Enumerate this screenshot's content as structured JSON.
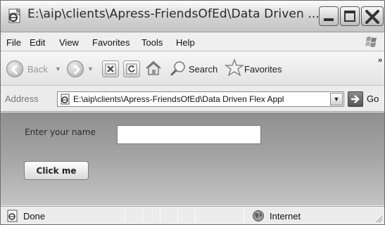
{
  "window": {
    "title": "E:\\aip\\clients\\Apress-FriendsOfEd\\Data Driven ..."
  },
  "menu": {
    "items": [
      "File",
      "Edit",
      "View",
      "Favorites",
      "Tools",
      "Help"
    ]
  },
  "toolbar": {
    "back_label": "Back",
    "search_label": "Search",
    "favorites_label": "Favorites",
    "overflow": "»"
  },
  "address": {
    "label": "Address",
    "value": "E:\\aip\\clients\\Apress-FriendsOfEd\\Data Driven Flex Appl",
    "go_label": "Go"
  },
  "app": {
    "name_label": "Enter your name",
    "name_value": "",
    "button_label": "Click me"
  },
  "status": {
    "text": "Done",
    "zone": "Internet"
  },
  "icons": {
    "window": "ie-page-icon",
    "back": "back-arrow-icon",
    "forward": "forward-arrow-icon",
    "stop": "stop-icon",
    "refresh": "refresh-icon",
    "home": "home-icon",
    "search": "search-icon",
    "favorites": "star-icon",
    "go": "go-arrow-icon",
    "zone": "globe-icon"
  }
}
